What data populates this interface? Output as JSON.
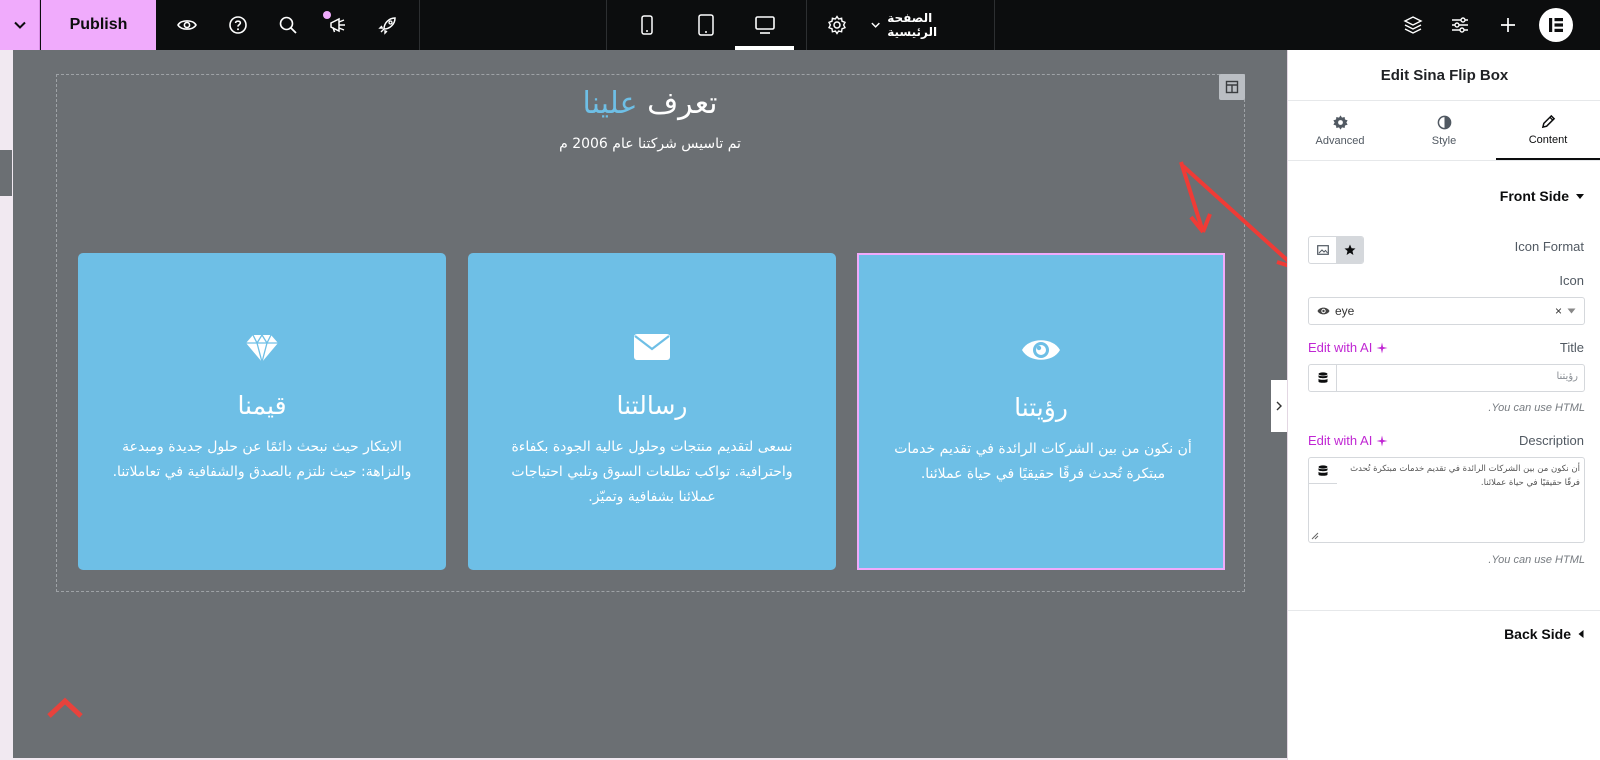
{
  "topbar": {
    "publish_label": "Publish",
    "page_name": "الصفحة الرئيسية",
    "icons": [
      "chevron-down",
      "eye",
      "help",
      "search",
      "megaphone",
      "rocket",
      "mobile",
      "tablet",
      "desktop",
      "settings",
      "layers",
      "sliders",
      "plus",
      "elementor-logo"
    ],
    "active_device": "desktop"
  },
  "canvas": {
    "heading_main": "تعرف",
    "heading_accent": "علينا",
    "subheading": "تم تاسيس شركتنا عام 2006 م",
    "accent_color": "#6ebfe6",
    "cards": [
      {
        "icon": "gem",
        "title": "قيمنا",
        "description": "الابتكار حيث نبحث دائمًا عن حلول جديدة ومبدعة والنزاهة: حيث نلتزم بالصدق والشفافية في تعاملاتنا."
      },
      {
        "icon": "envelope",
        "title": "رسالتنا",
        "description": "نسعى لتقديم منتجات وحلول عالية الجودة بكفاءة واحترافية. تواكب تطلعات السوق وتلبي احتياجات عملائنا بشفافية وتميّز."
      },
      {
        "icon": "eye",
        "title": "رؤيتنا",
        "description": "أن نكون من بين الشركات الرائدة في تقديم خدمات مبتكرة تُحدث فرقًا حقيقيًا في حياة عملائنا."
      }
    ]
  },
  "panel": {
    "title": "Edit Sina Flip Box",
    "tabs": [
      {
        "label": "Advanced",
        "icon": "gear"
      },
      {
        "label": "Style",
        "icon": "contrast"
      },
      {
        "label": "Content",
        "icon": "pencil"
      }
    ],
    "active_tab": "Content",
    "front_side": {
      "heading": "Front Side",
      "icon_format_label": "Icon Format",
      "icon_label": "Icon",
      "icon_value": "eye",
      "title_label": "Title",
      "title_value": "رؤيتنا",
      "edit_ai_label": "Edit with AI",
      "html_help": "You can use HTML.",
      "description_label": "Description",
      "description_value_line1": "أن نكون من بين الشركات الرائدة في تقديم خدمات مبتكرة تُحدث",
      "description_value_line2": "فرقًا حقيقيًا في حياة عملائنا."
    },
    "back_side": {
      "heading": "Back Side"
    }
  }
}
